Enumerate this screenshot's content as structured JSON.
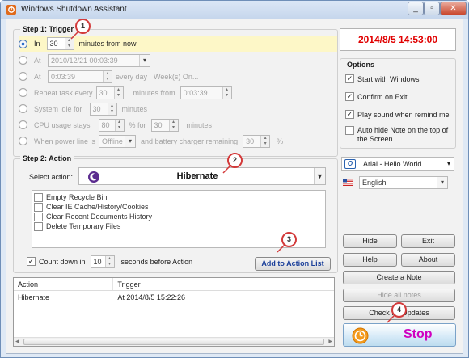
{
  "window": {
    "title": "Windows Shutdown Assistant"
  },
  "step1": {
    "title": "Step 1: Trigger",
    "in": {
      "label": "In",
      "value": "30",
      "suffix": "minutes from now"
    },
    "at1": {
      "label": "At",
      "value": "2010/12/21   00:03:39"
    },
    "at2": {
      "label": "At",
      "value": "0:03:39",
      "every": "every day",
      "weeks": "Week(s) On..."
    },
    "repeat": {
      "label": "Repeat task every",
      "value": "30",
      "from_label": "minutes from",
      "from_value": "0:03:39"
    },
    "idle": {
      "label": "System idle for",
      "value": "30",
      "suffix": "minutes"
    },
    "cpu": {
      "label": "CPU usage stays",
      "value": "80",
      "mid": "% for",
      "value2": "30",
      "suffix": "minutes"
    },
    "power": {
      "label": "When power line is",
      "value": "Offline",
      "mid": "and battery charger remaining",
      "value2": "30",
      "suffix": "%"
    }
  },
  "step2": {
    "title": "Step 2: Action",
    "select_label": "Select action:",
    "selected_action": "Hibernate",
    "checklist": [
      "Empty Recycle Bin",
      "Clear IE Cache/History/Cookies",
      "Clear Recent Documents History",
      "Delete Temporary Files"
    ],
    "countdown": {
      "label": "Count down in",
      "value": "10",
      "suffix": "seconds before Action",
      "checked": true
    },
    "add_button": "Add to Action List"
  },
  "table": {
    "columns": [
      "Action",
      "Trigger"
    ],
    "rows": [
      {
        "action": "Hibernate",
        "trigger": "At 2014/8/5 15:22:26"
      }
    ]
  },
  "clock": "2014/8/5 14:53:00",
  "options": {
    "title": "Options",
    "items": [
      "Start with Windows",
      "Confirm on Exit",
      "Play sound when remind me",
      "Auto hide Note on the top of the Screen"
    ],
    "font": "Arial   - Hello World",
    "language": "English"
  },
  "buttons": {
    "hide": "Hide",
    "exit": "Exit",
    "help": "Help",
    "about": "About",
    "create_note": "Create a Note",
    "hide_notes": "Hide all notes",
    "check_updates": "Check for Updates",
    "stop": "Stop"
  },
  "badges": [
    "1",
    "2",
    "3",
    "4"
  ],
  "colors": {
    "clock_text": "#e00000",
    "stop_text": "#d000c0",
    "badge_border": "#d33a3a",
    "highlight_row": "#fdf7c7"
  }
}
